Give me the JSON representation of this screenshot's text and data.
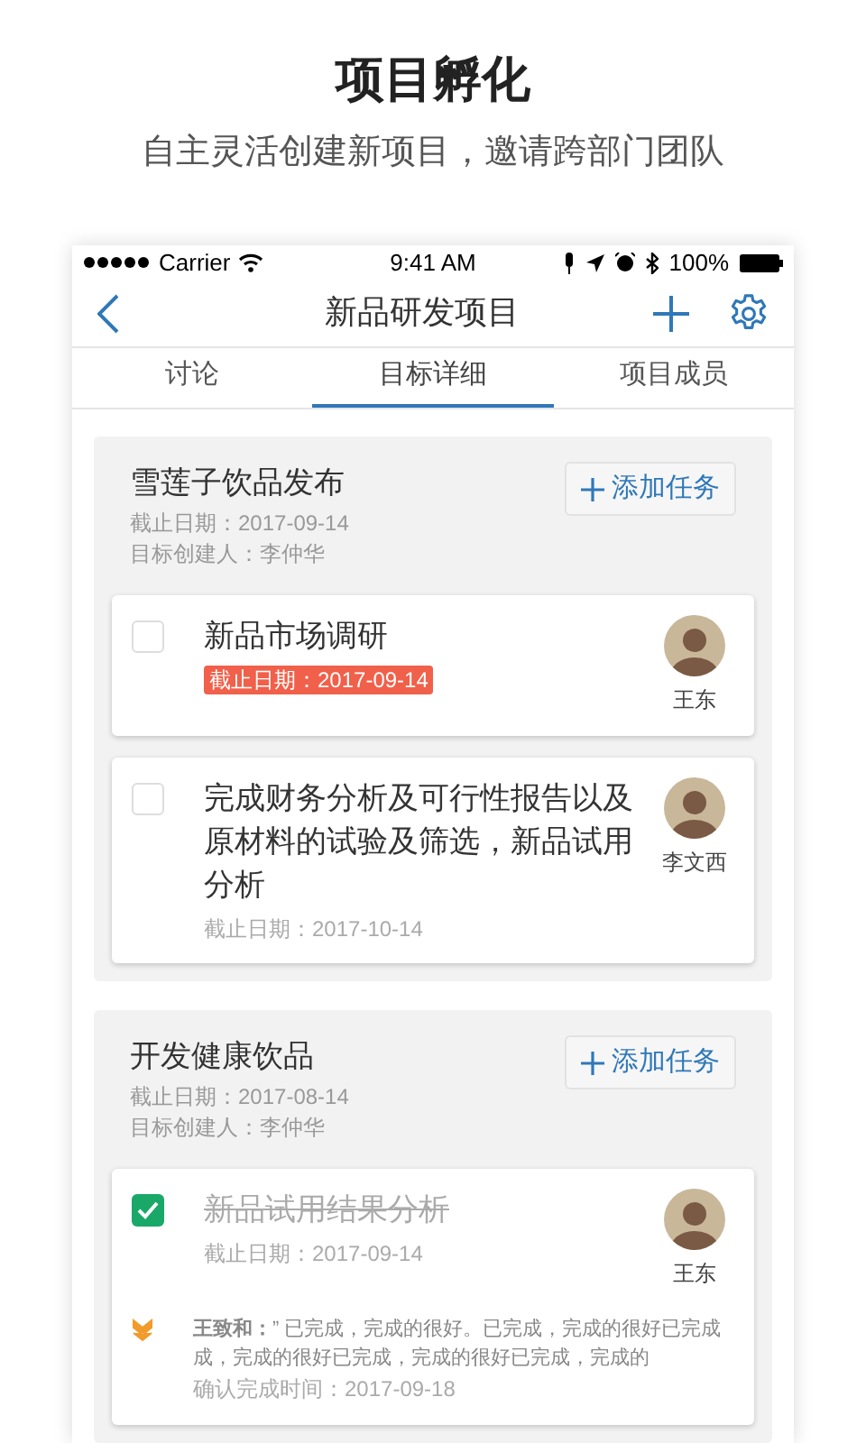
{
  "promo": {
    "title": "项目孵化",
    "subtitle": "自主灵活创建新项目，邀请跨部门团队"
  },
  "status_bar": {
    "carrier": "Carrier",
    "time": "9:41 AM",
    "battery": "100%"
  },
  "nav": {
    "title": "新品研发项目"
  },
  "tabs": [
    {
      "label": "讨论",
      "selected": false
    },
    {
      "label": "目标详细",
      "selected": true
    },
    {
      "label": "项目成员",
      "selected": false
    }
  ],
  "goals": [
    {
      "title": "雪莲子饮品发布",
      "due": "截止日期：2017-09-14",
      "creator": "目标创建人：李仲华",
      "add_button": "添加任务",
      "tasks": [
        {
          "title": "新品市场调研",
          "checked": false,
          "overdue": true,
          "due": "截止日期：2017-09-14",
          "assignee": "王东"
        },
        {
          "title": "完成财务分析及可行性报告以及原材料的试验及筛选，新品试用分析",
          "checked": false,
          "overdue": false,
          "due": "截止日期：2017-10-14",
          "assignee": "李文西"
        }
      ]
    },
    {
      "title": "开发健康饮品",
      "due": "截止日期：2017-08-14",
      "creator": "目标创建人：李仲华",
      "add_button": "添加任务",
      "tasks": [
        {
          "title": "新品试用结果分析",
          "checked": true,
          "overdue": false,
          "due": "截止日期：2017-09-14",
          "assignee": "王东",
          "comment": {
            "text": "**王致和：**” 已完成，完成的很好。已完成，完成的很好已完成成，完成的很好已完成，完成的很好已完成，完成的",
            "confirm_time": "确认完成时间：2017-09-18"
          }
        }
      ]
    }
  ]
}
